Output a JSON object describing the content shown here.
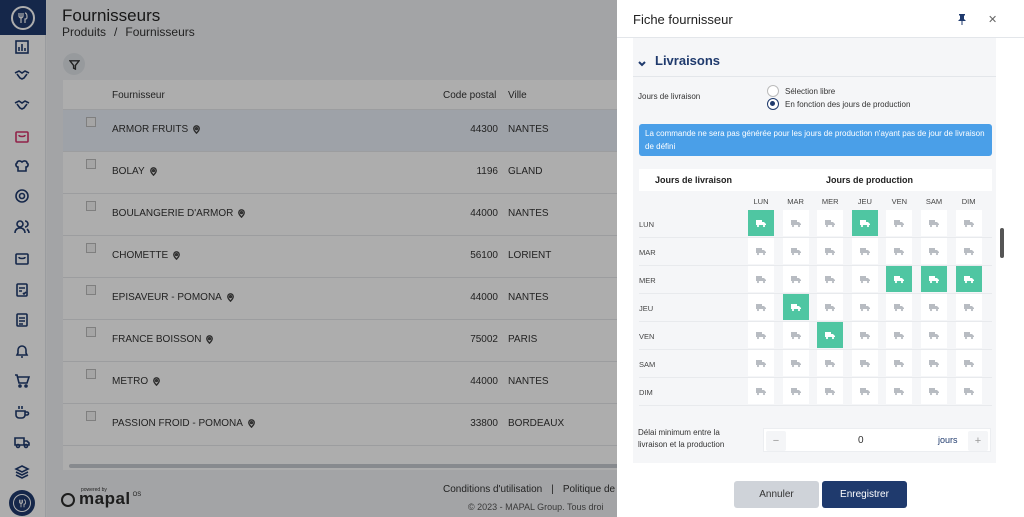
{
  "main": {
    "title": "Fournisseurs",
    "breadcrumb": [
      "Produits",
      "/",
      "Fournisseurs"
    ],
    "table": {
      "headers": {
        "supplier": "Fournisseur",
        "cp": "Code postal",
        "city": "Ville"
      },
      "rows": [
        {
          "name": "ARMOR FRUITS",
          "cp": "44300",
          "city": "NANTES",
          "selected": true
        },
        {
          "name": "BOLAY",
          "cp": "1196",
          "city": "GLAND"
        },
        {
          "name": "BOULANGERIE D'ARMOR",
          "cp": "44000",
          "city": "NANTES"
        },
        {
          "name": "CHOMETTE",
          "cp": "56100",
          "city": "LORIENT"
        },
        {
          "name": "EPISAVEUR - POMONA",
          "cp": "44000",
          "city": "NANTES"
        },
        {
          "name": "FRANCE BOISSON",
          "cp": "75002",
          "city": "PARIS"
        },
        {
          "name": "METRO",
          "cp": "44000",
          "city": "NANTES"
        },
        {
          "name": "PASSION FROID - POMONA",
          "cp": "33800",
          "city": "BORDEAUX"
        }
      ]
    },
    "footer": {
      "links": [
        "Conditions d'utilisation",
        "|",
        "Politique de"
      ],
      "copyright": "© 2023 - MAPAL Group. Tous droi",
      "powered_by": "powered by",
      "brand": "mapal",
      "brand_suffix": "OS"
    }
  },
  "drawer": {
    "title": "Fiche fournisseur",
    "section": "Livraisons",
    "jours_label": "Jours de livraison",
    "radio_options": [
      {
        "label": "Sélection libre",
        "checked": false
      },
      {
        "label": "En fonction des jours de production",
        "checked": true
      }
    ],
    "info": "La commande ne sera pas générée pour les jours de production n'ayant pas de jour de livraison de défini",
    "grid_header_left": "Jours de livraison",
    "grid_header_right": "Jours de production",
    "columns": [
      "LUN",
      "MAR",
      "MER",
      "JEU",
      "VEN",
      "SAM",
      "DIM"
    ],
    "rows": [
      "LUN",
      "MAR",
      "MER",
      "JEU",
      "VEN",
      "SAM",
      "DIM"
    ],
    "active_cells": [
      [
        0,
        0
      ],
      [
        0,
        3
      ],
      [
        2,
        4
      ],
      [
        2,
        5
      ],
      [
        2,
        6
      ],
      [
        3,
        1
      ],
      [
        4,
        2
      ]
    ],
    "delay_label": "Délai minimum entre la livraison et la production",
    "delay_value": "0",
    "delay_unit": "jours",
    "minus": "−",
    "plus": "+",
    "cancel": "Annuler",
    "save": "Enregistrer"
  },
  "colors": {
    "accent": "#1f3a6d",
    "active_cell": "#4fc6a2",
    "info": "#4a9fe8"
  }
}
